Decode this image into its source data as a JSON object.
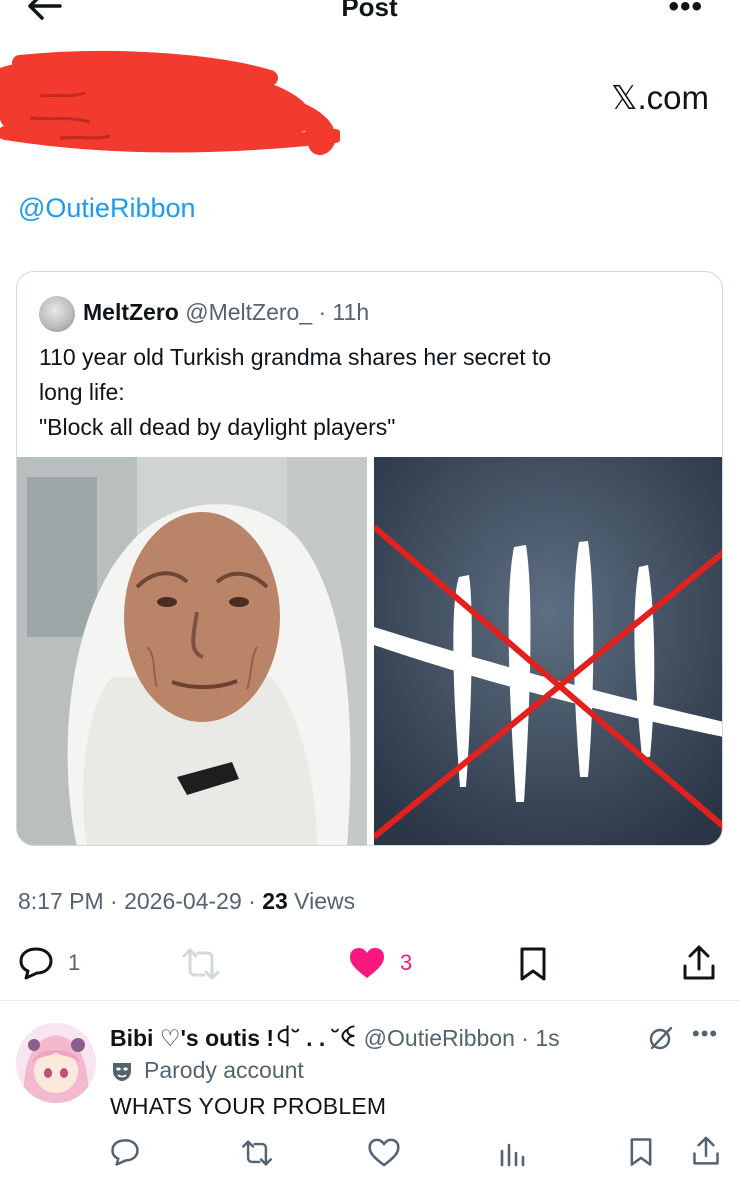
{
  "header": {
    "title": "Post"
  },
  "brand": {
    "watermark": "𝕏.com"
  },
  "post": {
    "mention": "@OutieRibbon",
    "timestamp": "8:17 PM · 2026-04-29 · ",
    "views_count": "23",
    "views_label": " Views",
    "reply_count": "1",
    "like_count": "3",
    "liked_color": "#f91880"
  },
  "quote": {
    "name": "MeltZero",
    "meta": " @MeltZero_ · 11h",
    "lines": [
      "110 year old Turkish grandma shares her secret to",
      "long life:",
      "\"Block all dead by daylight players\""
    ]
  },
  "reply": {
    "name": "Bibi ♡'s outis !ꒉ˘ . . ˘ꒊ",
    "meta": " @OutieRibbon · 1s",
    "badge": "Parody account",
    "text": "WHATS YOUR PROBLEM"
  },
  "colors": {
    "accent": "#1d9bf0",
    "secondary_text": "#536471",
    "redaction": "#f23a2e"
  },
  "icons": {
    "back": "arrow-left-icon",
    "more": "more-dots-icon",
    "reply": "reply-bubble-icon",
    "repost": "repost-icon",
    "like": "heart-icon",
    "bookmark": "bookmark-icon",
    "share": "share-icon",
    "analytics": "bar-chart-icon",
    "grok": "grok-icon",
    "parody": "mask-icon"
  }
}
